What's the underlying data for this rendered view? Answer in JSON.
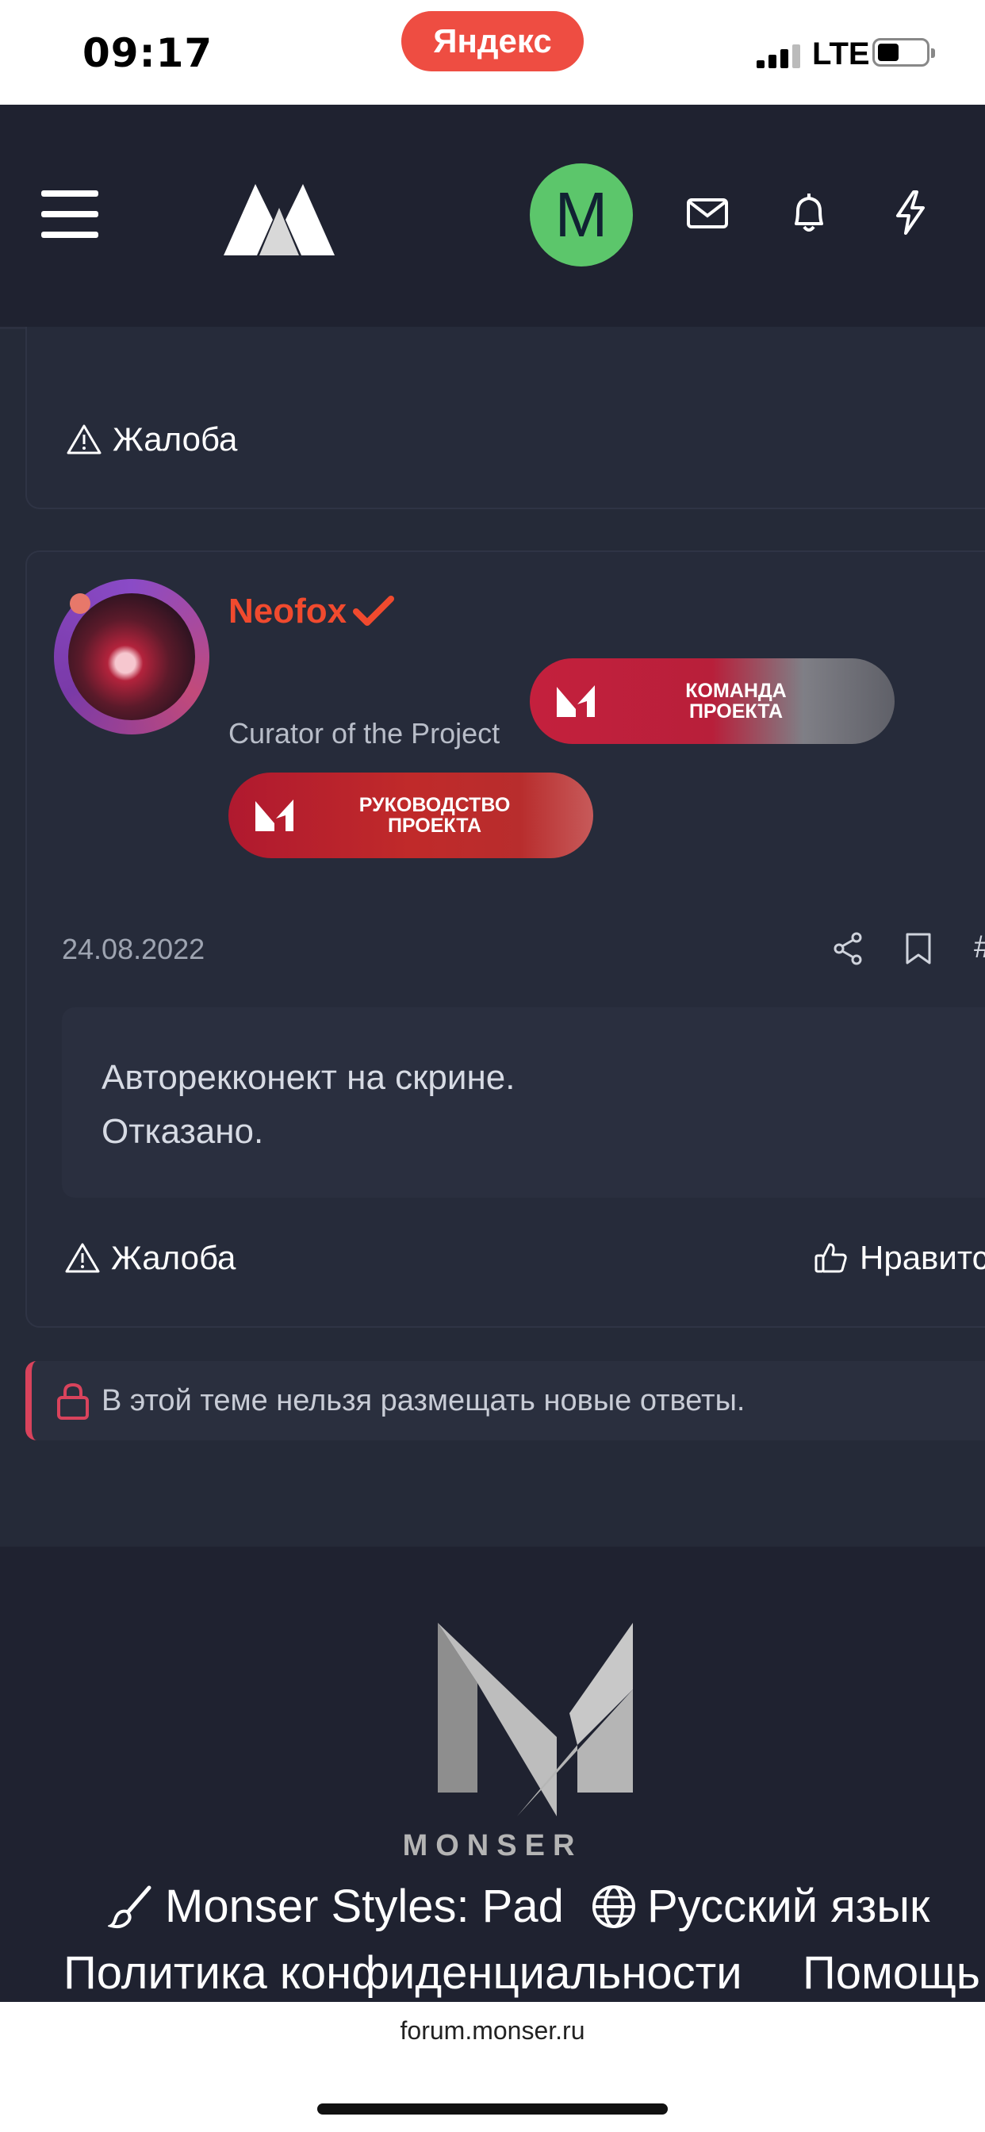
{
  "status_bar": {
    "time": "09:17",
    "browser_badge": "Яндекс",
    "network": "LTE"
  },
  "header": {
    "avatar_letter": "M"
  },
  "prev_post": {
    "complaint_label": "Жалоба"
  },
  "post": {
    "username": "Neofox",
    "user_title": "Curator of the Project",
    "banners": [
      "КОМАНДА\nПРОЕКТА",
      "РУКОВОДСТВО\nПРОЕКТА"
    ],
    "date": "24.08.2022",
    "message_lines": [
      "Авторекконект на скрине.",
      "Отказано."
    ],
    "complaint_label": "Жалоба",
    "like_label": "Нравится"
  },
  "locked_notice": "В этой теме нельзя размещать новые ответы.",
  "footer": {
    "brand": "MONSER",
    "style_label": "Monser Styles: Pad",
    "language_label": "Русский язык",
    "privacy_label": "Политика конфиденциальности",
    "help_label": "Помощь"
  },
  "browser": {
    "url": "forum.monser.ru"
  },
  "colors": {
    "accent_red": "#f04a2e",
    "avatar_green": "#5cc66b",
    "lock_red": "#d9435c",
    "header_bg": "#1f2230",
    "page_bg": "#252a38"
  }
}
